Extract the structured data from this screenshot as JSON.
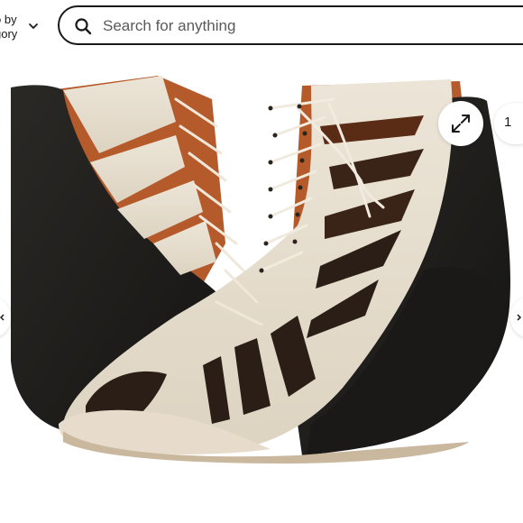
{
  "header": {
    "category_line1": "o by",
    "category_line2": "gory",
    "category_chevron_icon": "chevron-down-icon",
    "search": {
      "placeholder": "Search for anything",
      "icon": "search-icon"
    }
  },
  "gallery": {
    "image_alt": "Lace-up cutout peep-toe wedge bootie, cream upper with black leather wedge heel",
    "expand_icon": "expand-icon",
    "counter_text": "1",
    "nav_left_icon": "chevron-left-icon",
    "nav_right_icon": "chevron-right-icon"
  },
  "colors": {
    "cream_upper": "#e6ddcd",
    "black_wedge": "#1e1d1b",
    "tan_lining": "#b55a2a",
    "background": "#ffffff"
  }
}
